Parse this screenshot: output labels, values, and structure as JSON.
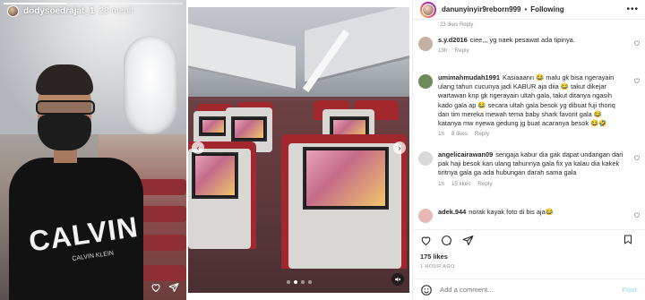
{
  "story": {
    "username": "dodysoedrajat_1",
    "time": "28 menit",
    "progress": 0.35,
    "shirt_brand": "CALVIN",
    "shirt_brand_sub": "CALVIN KLEIN"
  },
  "carousel": {
    "slide_count": 4,
    "active_slide": 1
  },
  "post": {
    "username": "danunyinyir9reborn999",
    "follow_separator": "•",
    "follow_status": "Following",
    "top_meta": "23 likes   Reply",
    "comments": [
      {
        "user": "s.y.d2016",
        "text": "ciee,,, yg naek pesawat ada tipinya.",
        "time": "19h",
        "likes": "",
        "reply": "Reply",
        "avatar_color": "#c5b0a6"
      },
      {
        "user": "umimahmudah1991",
        "text": "Kasiaaann 😂 malu gk bisa ngerayain ulang tahun cucunya jadi KABUR aja diia 😂 takut dikejar wartawan knp gk ngerayain ultah gala, takut ditanya ngasih kado gala ap 😂 secara ultah gala besok yg dibuat fuji thoriq dan tim mereka mewah tema baby shark favorit gala 😂 katanya mw nyewa gedung jg buat acaranya besok 😂🤣",
        "time": "1h",
        "likes": "8 likes",
        "reply": "Reply",
        "avatar_color": "#6f8a5a"
      },
      {
        "user": "angelicairawan09",
        "text": "sengaja kabur dia gak dapat undangan dari pak haji besok kan ulang tahunnya gala fix ya kalau dia kakek tiritnya gala ga ada hubungan darah sama gala",
        "time": "1h",
        "likes": "15 likes",
        "reply": "Reply",
        "avatar_color": "#d9d9d9"
      },
      {
        "user": "adek.944",
        "text": "norak kayak foto di bis aja😂",
        "time": "",
        "likes": "",
        "reply": "",
        "avatar_color": "#e8b8b5"
      }
    ],
    "likes": "175 likes",
    "time_ago": "1 HOUR AGO",
    "add_comment_placeholder": "Add a comment...",
    "post_label": "Post"
  },
  "colors": {
    "accent_post": "#b2dffc",
    "text": "#262626",
    "muted": "#8e8e8e",
    "seat_red": "#a3282d"
  }
}
